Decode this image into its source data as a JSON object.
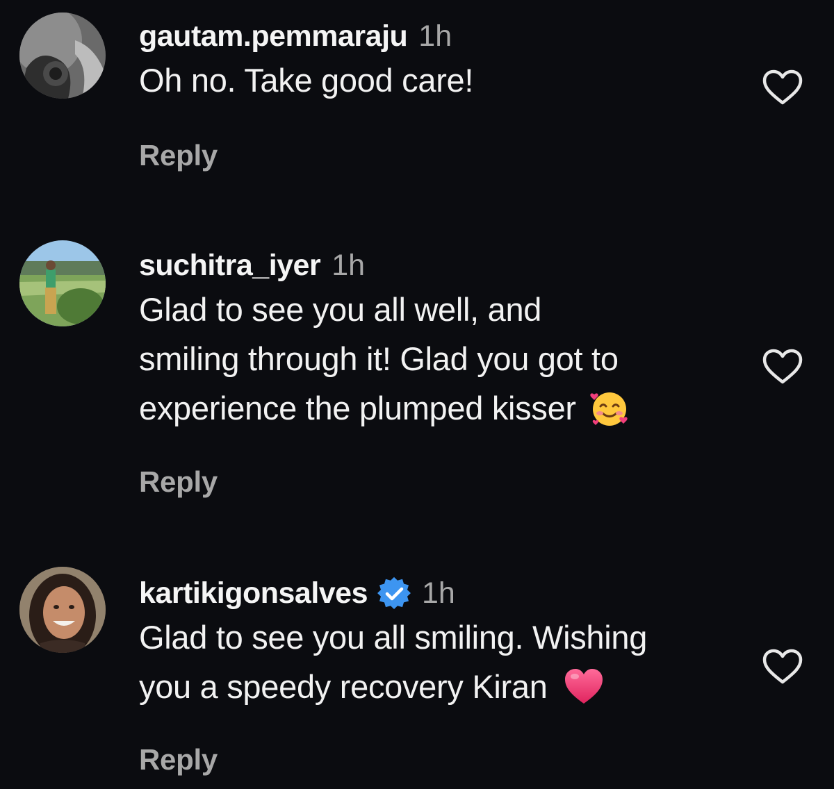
{
  "colors": {
    "background": "#0b0c10",
    "text": "#f2f2f2",
    "muted": "#a8a8a8",
    "verified": "#3d95f1",
    "heart_emoji": "#f23f7c"
  },
  "comments": [
    {
      "username": "gautam.pemmaraju",
      "verified": false,
      "time": "1h",
      "lines": [
        "Oh no. Take good care!"
      ],
      "emoji": null,
      "reply_label": "Reply",
      "like_icon": "heart-outline-icon"
    },
    {
      "username": "suchitra_iyer",
      "verified": false,
      "time": "1h",
      "lines": [
        "Glad to see you all well, and",
        "smiling through it! Glad you got to",
        "experience the plumped kisser"
      ],
      "emoji": "smiling-face-with-hearts-emoji",
      "reply_label": "Reply",
      "like_icon": "heart-outline-icon"
    },
    {
      "username": "kartikigonsalves",
      "verified": true,
      "time": "1h",
      "lines": [
        "Glad to see you all smiling. Wishing",
        "you a speedy recovery Kiran"
      ],
      "emoji": "red-heart-emoji",
      "reply_label": "Reply",
      "like_icon": "heart-outline-icon"
    }
  ]
}
